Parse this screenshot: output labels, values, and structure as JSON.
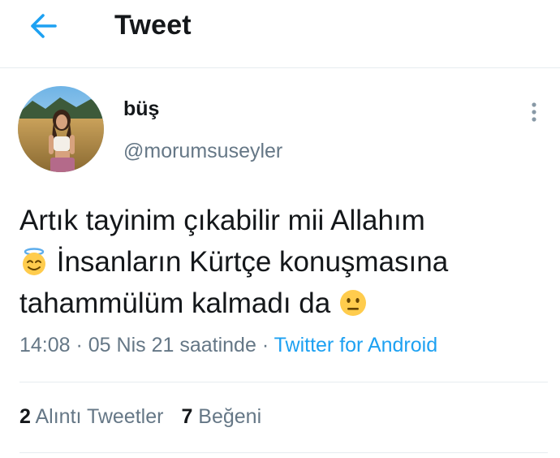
{
  "header": {
    "back_icon": "arrow-left-icon",
    "title": "Tweet",
    "accent": "#1da1f2"
  },
  "tweet": {
    "author": {
      "display_name": "büş",
      "handle": "@morumsuseyler",
      "avatar": "profile-photo"
    },
    "more_icon": "vertical-dots-icon",
    "text": {
      "line1": "Artık tayinim çıkabilir mii Allahım",
      "emoji1": "smiling-face-with-halo",
      "line2_after_emoji": " İnsanların Kürtçe konuşmasına",
      "line3": "tahammülüm kalmadı da ",
      "emoji2": "neutral-face"
    },
    "meta": {
      "time": "14:08",
      "separator1": " · ",
      "date": "05 Nis 21 saatinde",
      "separator2": " · ",
      "source": "Twitter for Android"
    },
    "stats": {
      "quote_count": "2",
      "quote_label": "Alıntı Tweetler",
      "like_count": "7",
      "like_label": "Beğeni"
    }
  },
  "colors": {
    "text": "#14171a",
    "secondary": "#657786",
    "link": "#1da1f2",
    "divider": "#e6ecf0"
  }
}
